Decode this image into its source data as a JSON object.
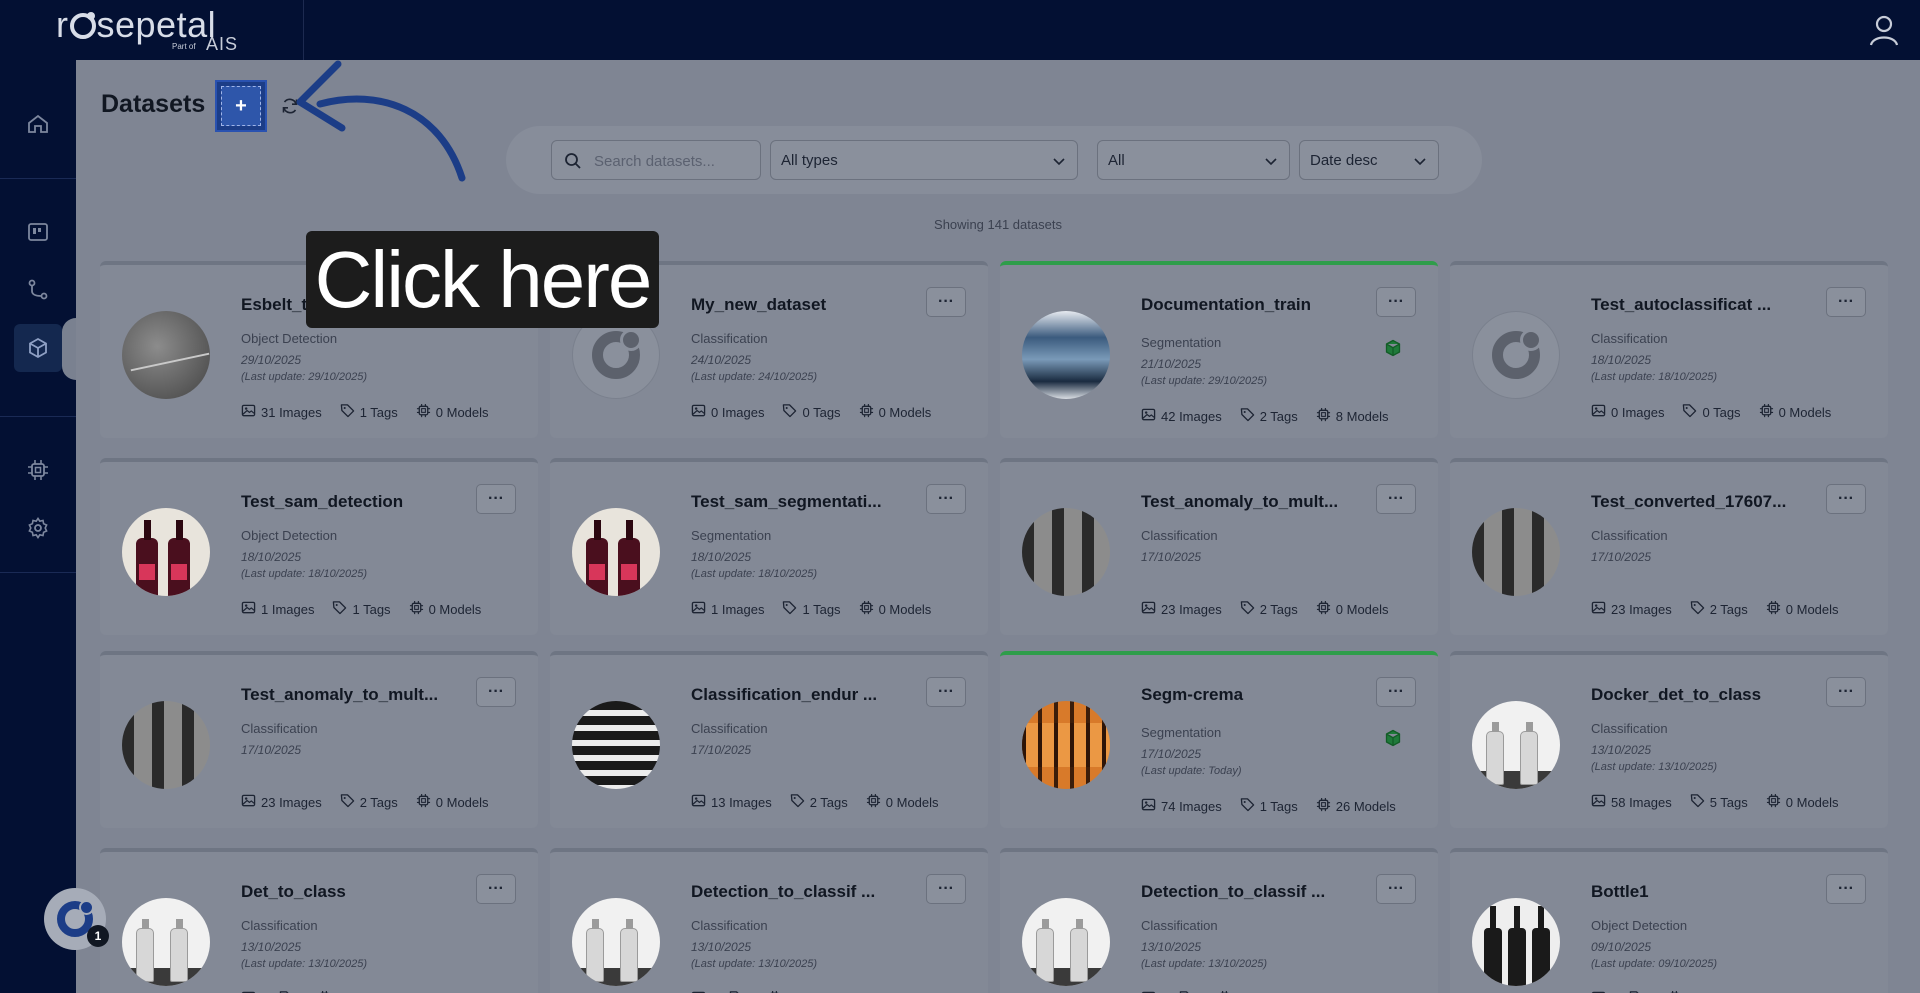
{
  "brand": {
    "name": "rosepetal",
    "part_of": "Part of",
    "group": "AIS"
  },
  "page": {
    "title": "Datasets",
    "add_label": "+",
    "showing": "Showing 141 datasets"
  },
  "filters": {
    "search_placeholder": "Search datasets...",
    "type_selected": "All types",
    "status_selected": "All",
    "sort_selected": "Date desc"
  },
  "tooltip": {
    "text": "Click here"
  },
  "notifications": {
    "count": "1"
  },
  "datasets": [
    {
      "name": "Esbelt_test",
      "type": "Object Detection",
      "date": "29/10/2025",
      "updated": "(Last update: 29/10/2025)",
      "images": "31 Images",
      "tags": "1 Tags",
      "models": "0 Models",
      "menu": "···"
    },
    {
      "name": "My_new_dataset",
      "type": "Classification",
      "date": "24/10/2025",
      "updated": "(Last update: 24/10/2025)",
      "images": "0 Images",
      "tags": "0 Tags",
      "models": "0 Models",
      "menu": "···"
    },
    {
      "name": "Documentation_train",
      "type": "Segmentation",
      "date": "21/10/2025",
      "updated": "(Last update: 29/10/2025)",
      "images": "42 Images",
      "tags": "2 Tags",
      "models": "8 Models",
      "menu": "···"
    },
    {
      "name": "Test_autoclassificat ...",
      "type": "Classification",
      "date": "18/10/2025",
      "updated": "(Last update: 18/10/2025)",
      "images": "0 Images",
      "tags": "0 Tags",
      "models": "0 Models",
      "menu": "···"
    },
    {
      "name": "Test_sam_detection",
      "type": "Object Detection",
      "date": "18/10/2025",
      "updated": "(Last update: 18/10/2025)",
      "images": "1 Images",
      "tags": "1 Tags",
      "models": "0 Models",
      "menu": "···"
    },
    {
      "name": "Test_sam_segmentati...",
      "type": "Segmentation",
      "date": "18/10/2025",
      "updated": "(Last update: 18/10/2025)",
      "images": "1 Images",
      "tags": "1 Tags",
      "models": "0 Models",
      "menu": "···"
    },
    {
      "name": "Test_anomaly_to_mult...",
      "type": "Classification",
      "date": "17/10/2025",
      "updated": "",
      "images": "23 Images",
      "tags": "2 Tags",
      "models": "0 Models",
      "menu": "···"
    },
    {
      "name": "Test_converted_17607...",
      "type": "Classification",
      "date": "17/10/2025",
      "updated": "",
      "images": "23 Images",
      "tags": "2 Tags",
      "models": "0 Models",
      "menu": "···"
    },
    {
      "name": "Test_anomaly_to_mult...",
      "type": "Classification",
      "date": "17/10/2025",
      "updated": "",
      "images": "23 Images",
      "tags": "2 Tags",
      "models": "0 Models",
      "menu": "···"
    },
    {
      "name": "Classification_endur ...",
      "type": "Classification",
      "date": "17/10/2025",
      "updated": "",
      "images": "13 Images",
      "tags": "2 Tags",
      "models": "0 Models",
      "menu": "···"
    },
    {
      "name": "Segm-crema",
      "type": "Segmentation",
      "date": "17/10/2025",
      "updated": "(Last update: Today)",
      "images": "74 Images",
      "tags": "1 Tags",
      "models": "26 Models",
      "menu": "···"
    },
    {
      "name": "Docker_det_to_class",
      "type": "Classification",
      "date": "13/10/2025",
      "updated": "(Last update: 13/10/2025)",
      "images": "58 Images",
      "tags": "5 Tags",
      "models": "0 Models",
      "menu": "···"
    },
    {
      "name": "Det_to_class",
      "type": "Classification",
      "date": "13/10/2025",
      "updated": "(Last update: 13/10/2025)",
      "images": "",
      "tags": "",
      "models": "",
      "menu": "···"
    },
    {
      "name": "Detection_to_classif ...",
      "type": "Classification",
      "date": "13/10/2025",
      "updated": "(Last update: 13/10/2025)",
      "images": "",
      "tags": "",
      "models": "",
      "menu": "···"
    },
    {
      "name": "Detection_to_classif ...",
      "type": "Classification",
      "date": "13/10/2025",
      "updated": "(Last update: 13/10/2025)",
      "images": "",
      "tags": "",
      "models": "",
      "menu": "···"
    },
    {
      "name": "Bottle1",
      "type": "Object Detection",
      "date": "09/10/2025",
      "updated": "(Last update: 09/10/2025)",
      "images": "",
      "tags": "",
      "models": "",
      "menu": "···"
    }
  ]
}
